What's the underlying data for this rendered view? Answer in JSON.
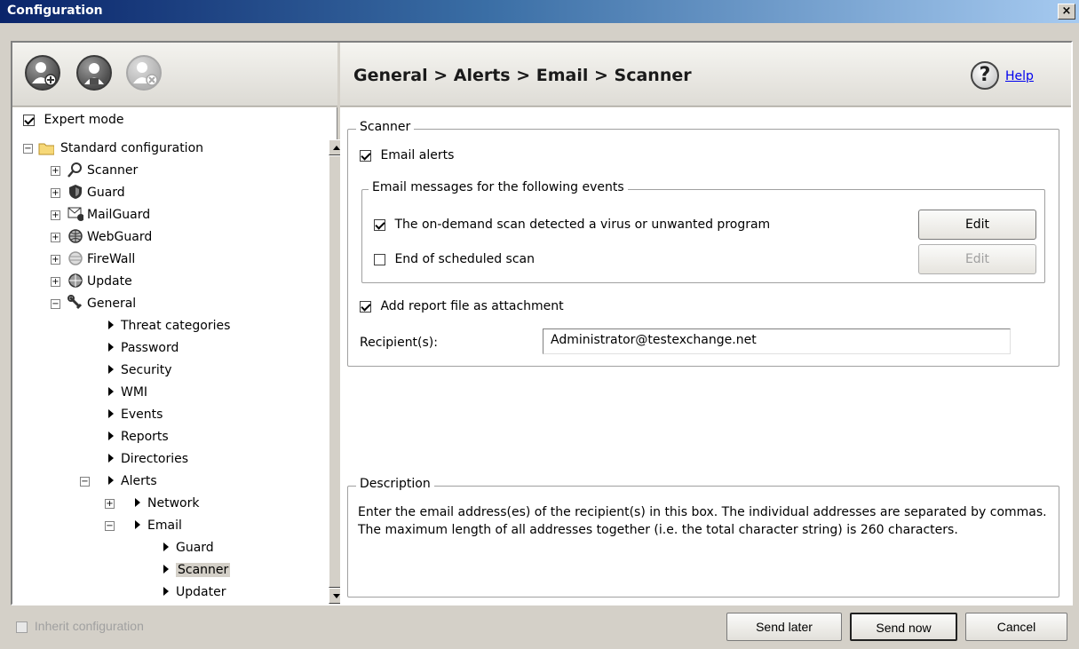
{
  "window": {
    "title": "Configuration",
    "close_label": "×"
  },
  "toolbar": {
    "icons": [
      "add-profile-icon",
      "profile-icon",
      "delete-profile-icon"
    ],
    "breadcrumb": "General > Alerts > Email > Scanner",
    "help_label": "Help"
  },
  "tree": {
    "expert_mode_label": "Expert mode",
    "root": "Standard configuration",
    "items": {
      "scanner": "Scanner",
      "guard": "Guard",
      "mailguard": "MailGuard",
      "webguard": "WebGuard",
      "firewall": "FireWall",
      "update": "Update",
      "general": "General",
      "threat_categories": "Threat categories",
      "password": "Password",
      "security": "Security",
      "wmi": "WMI",
      "events": "Events",
      "reports": "Reports",
      "directories": "Directories",
      "alerts": "Alerts",
      "network": "Network",
      "email": "Email",
      "email_guard": "Guard",
      "email_scanner": "Scanner",
      "email_updater": "Updater"
    },
    "selected": "Scanner"
  },
  "scanner_group": {
    "legend": "Scanner",
    "email_alerts_label": "Email alerts",
    "email_alerts_checked": true,
    "events_group": {
      "legend": "Email messages for the following events",
      "event1_label": "The on-demand scan detected a virus or unwanted program",
      "event1_checked": true,
      "event2_label": "End of scheduled scan",
      "event2_checked": false,
      "edit_label": "Edit"
    },
    "attach_label": "Add report file as attachment",
    "attach_checked": true,
    "recipient_label": "Recipient(s):",
    "recipient_value": "Administrator@testexchange.net"
  },
  "description": {
    "legend": "Description",
    "text": "Enter the email address(es) of the recipient(s) in this box. The individual addresses are separated by commas. The maximum length of all addresses together (i.e. the total character string) is 260 characters."
  },
  "footer": {
    "inherit_label": "Inherit configuration",
    "send_later_label": "Send later",
    "send_now_label": "Send now",
    "cancel_label": "Cancel"
  }
}
